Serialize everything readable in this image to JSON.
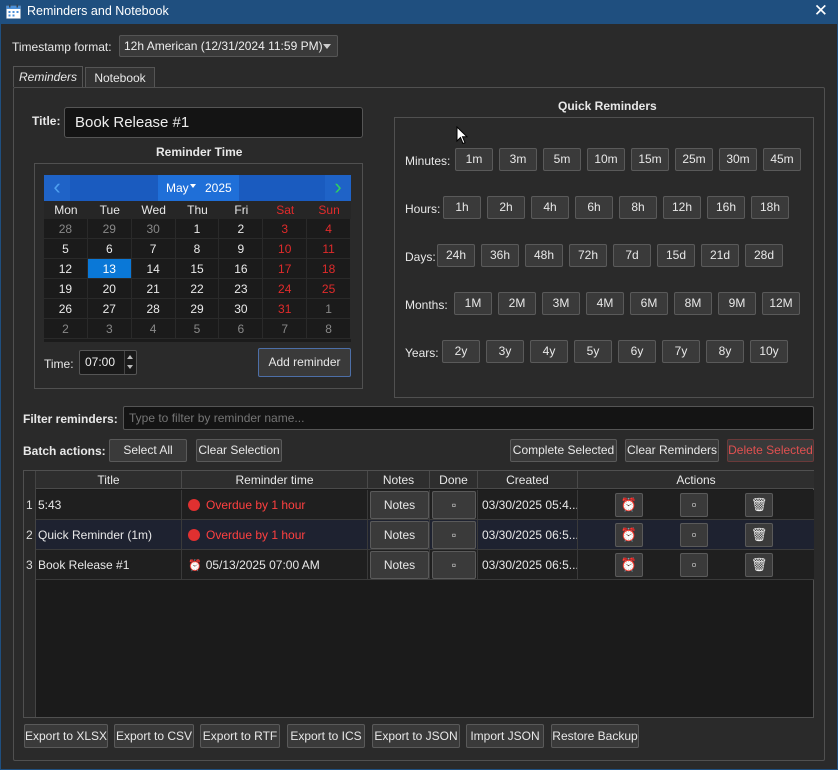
{
  "window": {
    "title": "Reminders and Notebook",
    "close_glyph": "✕",
    "icon": "calendar-app-icon"
  },
  "timestamp": {
    "label": "Timestamp format:",
    "value": "12h American (12/31/2024 11:59 PM)"
  },
  "tabs": [
    {
      "label": "Reminders",
      "active": true
    },
    {
      "label": "Notebook",
      "active": false
    }
  ],
  "form": {
    "title_label": "Title:",
    "title_value": "Book Release #1",
    "reminder_time_label": "Reminder Time",
    "time_label": "Time:",
    "time_value": "07:00",
    "add_button": "Add reminder"
  },
  "calendar": {
    "month": "May",
    "year": "2025",
    "prev_glyph": "‹",
    "next_glyph": "›",
    "weekdays": [
      "Mon",
      "Tue",
      "Wed",
      "Thu",
      "Fri",
      "Sat",
      "Sun"
    ],
    "weeks": [
      [
        "28",
        "29",
        "30",
        "1",
        "2",
        "3",
        "4"
      ],
      [
        "5",
        "6",
        "7",
        "8",
        "9",
        "10",
        "11"
      ],
      [
        "12",
        "13",
        "14",
        "15",
        "16",
        "17",
        "18"
      ],
      [
        "19",
        "20",
        "21",
        "22",
        "23",
        "24",
        "25"
      ],
      [
        "26",
        "27",
        "28",
        "29",
        "30",
        "31",
        "1"
      ],
      [
        "2",
        "3",
        "4",
        "5",
        "6",
        "7",
        "8"
      ]
    ],
    "selected_day": "13",
    "colors": {
      "header": "#1a5bbf",
      "selected": "#0a78d7",
      "weekend": "#e02b2b"
    }
  },
  "quick": {
    "title": "Quick Reminders",
    "rows": [
      {
        "label": "Minutes:",
        "items": [
          "1m",
          "3m",
          "5m",
          "10m",
          "15m",
          "25m",
          "30m",
          "45m"
        ]
      },
      {
        "label": "Hours:",
        "items": [
          "1h",
          "2h",
          "4h",
          "6h",
          "8h",
          "12h",
          "16h",
          "18h"
        ]
      },
      {
        "label": "Days:",
        "items": [
          "24h",
          "36h",
          "48h",
          "72h",
          "7d",
          "15d",
          "21d",
          "28d"
        ]
      },
      {
        "label": "Months:",
        "items": [
          "1M",
          "2M",
          "3M",
          "4M",
          "6M",
          "8M",
          "9M",
          "12M"
        ]
      },
      {
        "label": "Years:",
        "items": [
          "2y",
          "3y",
          "4y",
          "5y",
          "6y",
          "7y",
          "8y",
          "10y"
        ]
      }
    ]
  },
  "filter": {
    "label": "Filter reminders:",
    "placeholder": "Type to filter by reminder name..."
  },
  "batch": {
    "label": "Batch actions:",
    "select_all": "Select All",
    "clear_selection": "Clear Selection",
    "complete_selected": "Complete Selected",
    "clear_reminders": "Clear Reminders",
    "delete_selected": "Delete Selected"
  },
  "table": {
    "headers": [
      "Title",
      "Reminder time",
      "Notes",
      "Done",
      "Created",
      "Actions"
    ],
    "rows": [
      {
        "num": "1",
        "title": "5:43",
        "time": "Overdue by 1 hour",
        "overdue": true,
        "notes": "Notes",
        "done_glyph": "▫",
        "created": "03/30/2025 05:4..."
      },
      {
        "num": "2",
        "title": "Quick Reminder (1m)",
        "time": "Overdue by 1 hour",
        "overdue": true,
        "notes": "Notes",
        "done_glyph": "▫",
        "created": "03/30/2025 06:5..."
      },
      {
        "num": "3",
        "title": "Book Release #1",
        "time": "05/13/2025 07:00 AM",
        "overdue": false,
        "notes": "Notes",
        "done_glyph": "▫",
        "created": "03/30/2025 06:5..."
      }
    ],
    "action_icons": [
      "alarm-clock-icon",
      "square-icon",
      "trash-icon"
    ],
    "action_glyphs": {
      "alarm": "⏰",
      "square": "▫",
      "trash": "🗑"
    }
  },
  "export": [
    "Export to XLSX",
    "Export to CSV",
    "Export to RTF",
    "Export to ICS",
    "Export to JSON",
    "Import JSON",
    "Restore Backup"
  ]
}
